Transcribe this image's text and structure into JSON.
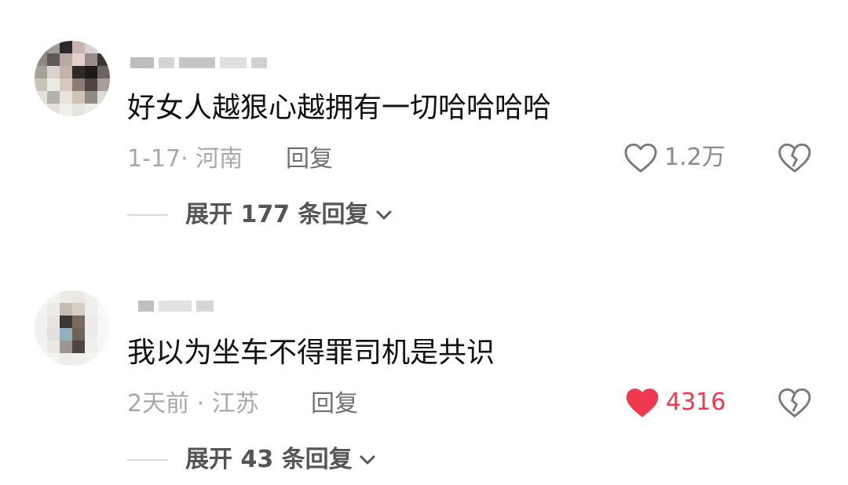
{
  "comments": [
    {
      "text": "好女人越狠心越拥有一切哈哈哈哈",
      "time_location": "1-17· 河南",
      "reply_label": "回复",
      "like_count": "1.2万",
      "liked": false,
      "expand_label": "展开 177 条回复"
    },
    {
      "text": "我以为坐车不得罪司机是共识",
      "time_location": "2天前 · 江苏",
      "reply_label": "回复",
      "like_count": "4316",
      "liked": true,
      "expand_label": "展开 43 条回复"
    }
  ],
  "colors": {
    "liked_red": "#f0384f",
    "icon_gray": "#7a7a7a",
    "meta_gray": "#a8a8a8"
  },
  "icons": {
    "like": "heart-outline-icon",
    "liked": "heart-filled-icon",
    "dislike": "broken-heart-icon",
    "expand": "chevron-down-icon"
  }
}
